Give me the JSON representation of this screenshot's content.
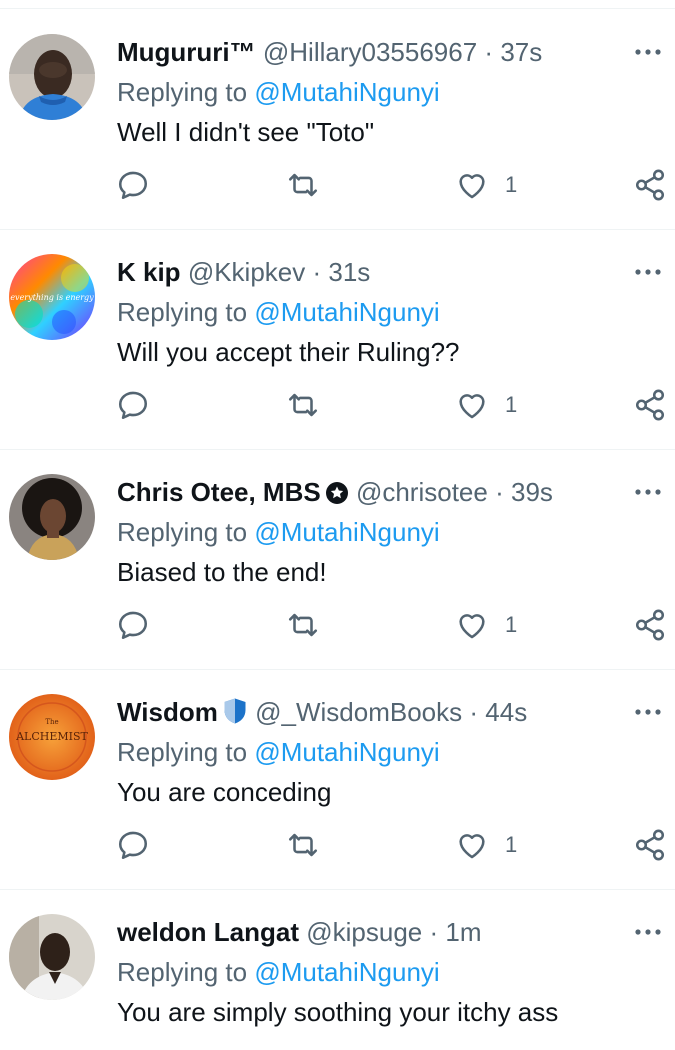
{
  "reply_prefix": "Replying to",
  "tweets": [
    {
      "display_name": "Mugururi™",
      "handle": "@Hillary03556967",
      "separator": "·",
      "time": "37s",
      "reply_to": "@MutahiNgunyi",
      "text": "Well I didn't see \"Toto\"",
      "likes": "1"
    },
    {
      "display_name": "K kip",
      "handle": "@Kkipkev",
      "separator": "·",
      "time": "31s",
      "reply_to": "@MutahiNgunyi",
      "text": "Will you accept their Ruling??",
      "likes": "1",
      "avatar_text": "everything is energy"
    },
    {
      "display_name": "Chris Otee, MBS",
      "handle": "@chrisotee",
      "separator": "·",
      "time": "39s",
      "reply_to": "@MutahiNgunyi",
      "text": "Biased to the end!",
      "likes": "1",
      "badge_icon": "star-circle-icon"
    },
    {
      "display_name": "Wisdom",
      "handle": "@_WisdomBooks",
      "separator": "·",
      "time": "44s",
      "reply_to": "@MutahiNgunyi",
      "text": "You are conceding",
      "likes": "1",
      "badge_icon": "blue-shield-icon",
      "avatar_text_small": "The",
      "avatar_text": "ALCHEMIST"
    },
    {
      "display_name": "weldon Langat",
      "handle": "@kipsuge",
      "separator": "·",
      "time": "1m",
      "reply_to": "@MutahiNgunyi",
      "text": "You are simply soothing your itchy ass",
      "likes": ""
    }
  ],
  "colors": {
    "text": "#0f1419",
    "secondary": "#536471",
    "mention": "#1d9bf0",
    "divider": "#eff3f4"
  },
  "icons": [
    "more-icon",
    "reply-icon",
    "retweet-icon",
    "like-icon",
    "share-icon"
  ]
}
